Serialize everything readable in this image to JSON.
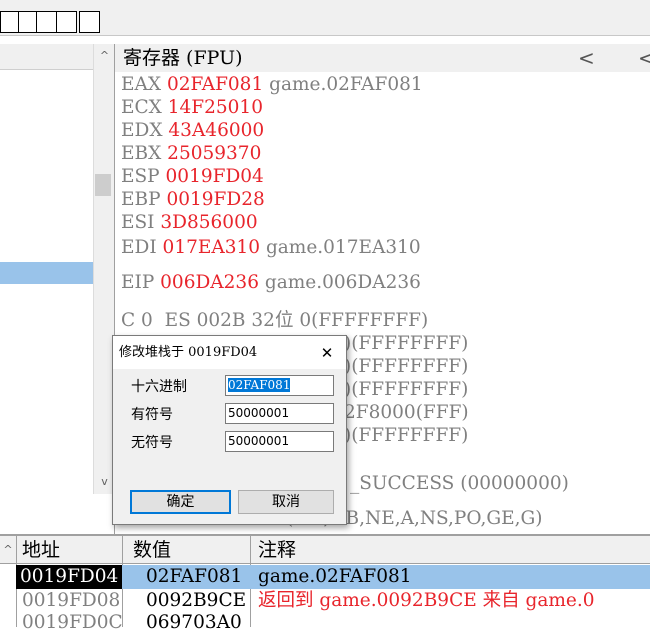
{
  "register_pane": {
    "title": "寄存器 (FPU)",
    "nav_prev": "<",
    "nav_prev2": "<",
    "registers": [
      {
        "name": "EAX",
        "value": "02FAF081",
        "comment": "game.02FAF081"
      },
      {
        "name": "ECX",
        "value": "14F25010",
        "comment": ""
      },
      {
        "name": "EDX",
        "value": "43A46000",
        "comment": ""
      },
      {
        "name": "EBX",
        "value": "25059370",
        "comment": ""
      },
      {
        "name": "ESP",
        "value": "0019FD04",
        "comment": ""
      },
      {
        "name": "EBP",
        "value": "0019FD28",
        "comment": ""
      },
      {
        "name": "ESI",
        "value": "3D856000",
        "comment": ""
      },
      {
        "name": "EDI",
        "value": "017EA310",
        "comment": "game.017EA310"
      }
    ],
    "eip": {
      "name": "EIP",
      "value": "006DA236",
      "comment": "game.006DA236"
    },
    "segments": [
      "C 0  ES 002B 32位 0(FFFFFFFF)",
      ")(FFFFFFFF)",
      ")(FFFFFFFF)",
      ")(FFFFFFFF)",
      "2F8000(FFF)",
      ")(FFFFFFFF)"
    ],
    "last_error": "_SUCCESS (00000000)",
    "efl": "(NO,NB,NE,A,NS,PO,GE,G)"
  },
  "left_pane": {
    "scroll_up": "^",
    "scroll_down": "v"
  },
  "stack_pane": {
    "scroll_up": "^",
    "columns": {
      "address": "地址",
      "value": "数值",
      "comment": "注释"
    },
    "rows": [
      {
        "address": "0019FD04",
        "value": "02FAF081",
        "comment": "game.02FAF081"
      },
      {
        "address": "0019FD08",
        "value": "0092B9CE",
        "comment": "返回到 game.0092B9CE 来自 game.0"
      },
      {
        "address": "0019FD0C",
        "value": "069703A0",
        "comment": ""
      }
    ]
  },
  "dialog": {
    "title": "修改堆栈于 0019FD04",
    "close": "✕",
    "fields": [
      {
        "label": "十六进制",
        "value": "02FAF081"
      },
      {
        "label": "有符号",
        "value": "50000001"
      },
      {
        "label": "无符号",
        "value": "50000001"
      }
    ],
    "ok_label": "确定",
    "cancel_label": "取消"
  },
  "colors": {
    "register_value": "#e8252c",
    "selection": "#99c3ea",
    "accent": "#0078d7"
  }
}
